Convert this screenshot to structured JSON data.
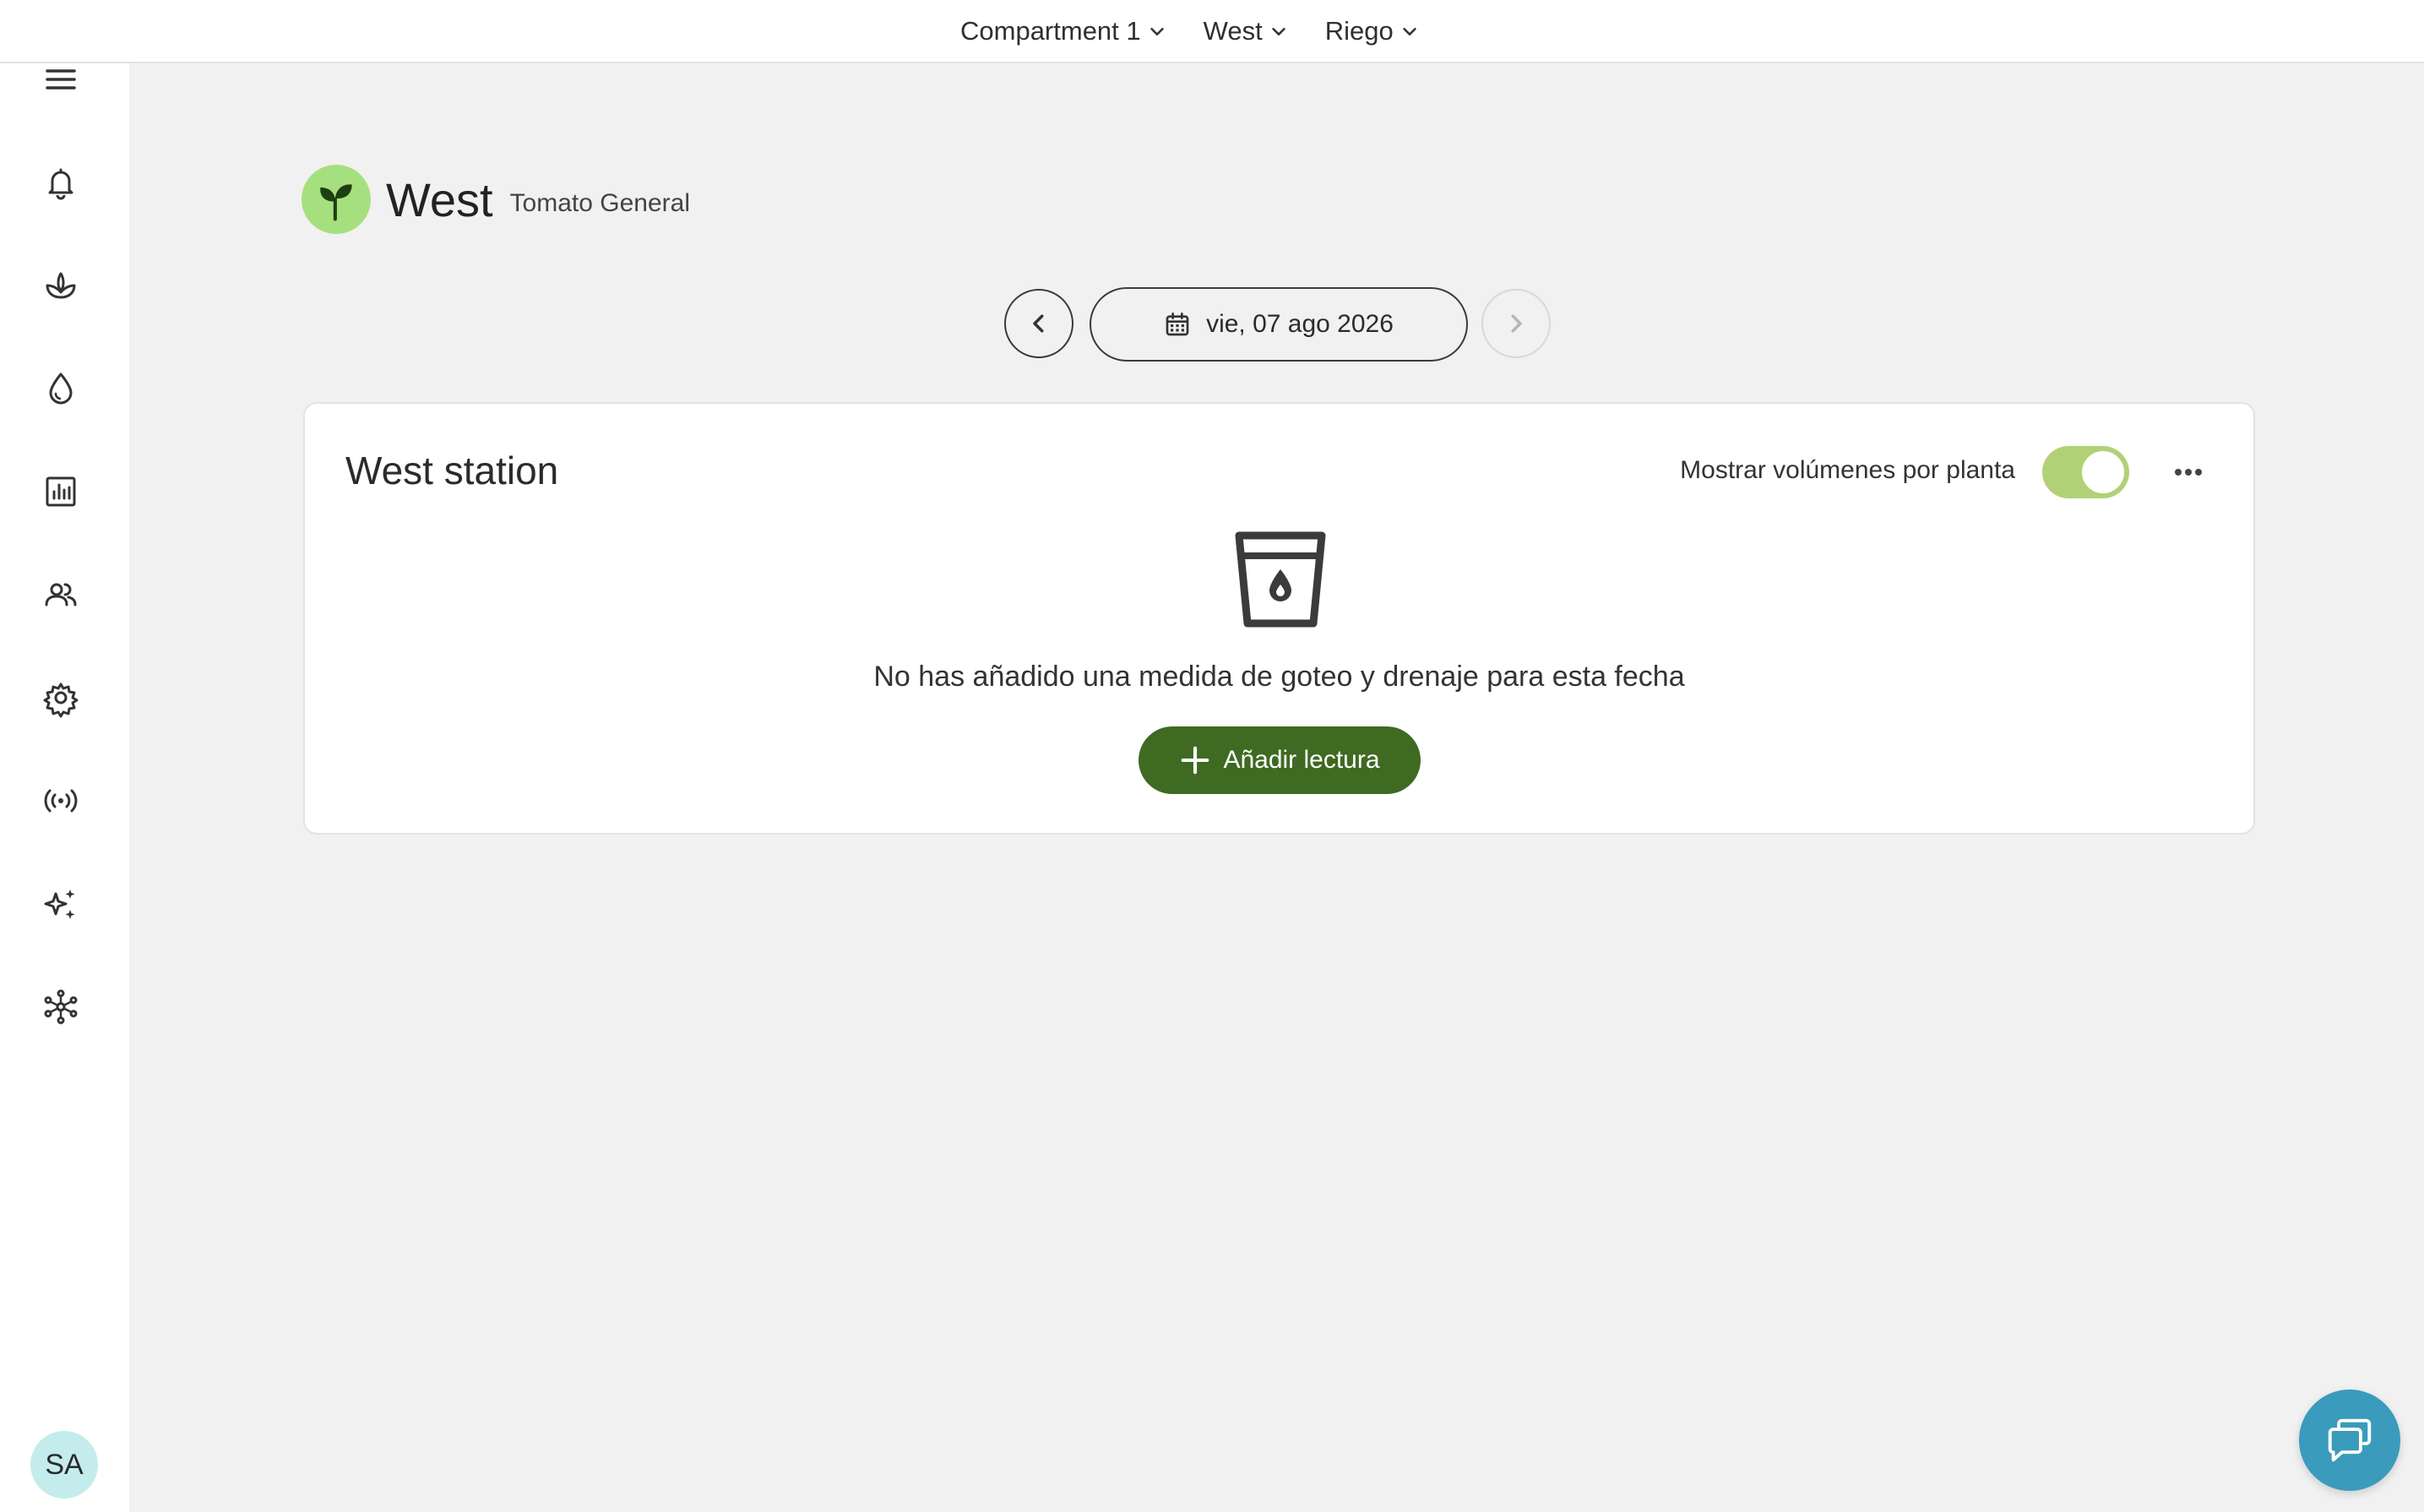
{
  "topbar": {
    "selectors": [
      {
        "label": "Compartment 1"
      },
      {
        "label": "West"
      },
      {
        "label": "Riego"
      }
    ]
  },
  "sidebar": {
    "items": [
      {
        "icon": "menu-icon"
      },
      {
        "icon": "bell-icon"
      },
      {
        "icon": "plant-icon"
      },
      {
        "icon": "drop-icon"
      },
      {
        "icon": "chart-icon"
      },
      {
        "icon": "users-icon"
      },
      {
        "icon": "gear-icon"
      },
      {
        "icon": "broadcast-icon"
      },
      {
        "icon": "sparkles-icon"
      },
      {
        "icon": "network-icon"
      }
    ],
    "avatar_initials": "SA"
  },
  "header": {
    "title": "West",
    "subtitle": "Tomato General",
    "badge_color": "#a6e07e"
  },
  "date_nav": {
    "date": "vie, 07 ago 2026"
  },
  "card": {
    "title": "West station",
    "toggle_label": "Mostrar volúmenes por planta",
    "toggle_on": true,
    "empty_message": "No has añadido una medida de goteo y drenaje para esta fecha",
    "add_button_label": "Añadir lectura",
    "accent_color": "#3f6a22"
  }
}
